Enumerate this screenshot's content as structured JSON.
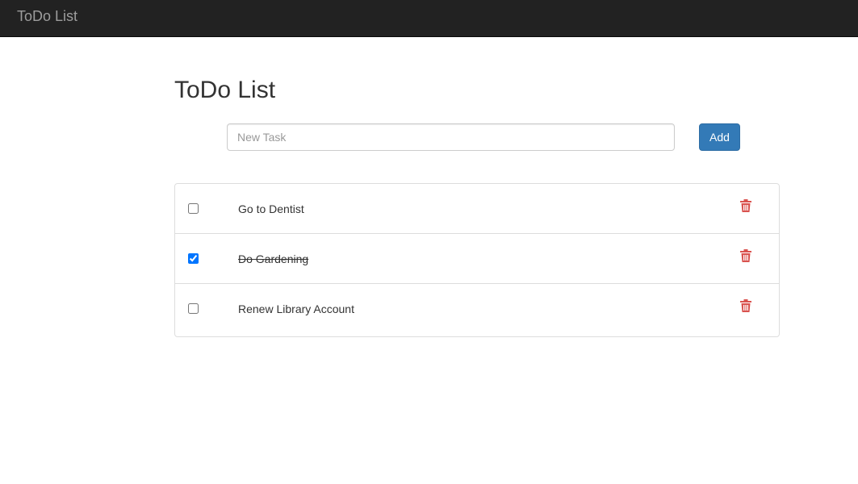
{
  "navbar": {
    "brand": "ToDo List"
  },
  "main": {
    "title": "ToDo List",
    "input": {
      "placeholder": "New Task",
      "value": ""
    },
    "add_label": "Add"
  },
  "tasks": [
    {
      "label": "Go to Dentist",
      "done": false
    },
    {
      "label": "Do Gardening",
      "done": true
    },
    {
      "label": "Renew Library Account",
      "done": false
    }
  ],
  "icons": {
    "delete": "trash-icon"
  },
  "colors": {
    "navbar": "#222222",
    "primary": "#337ab7",
    "danger": "#d9534f"
  }
}
